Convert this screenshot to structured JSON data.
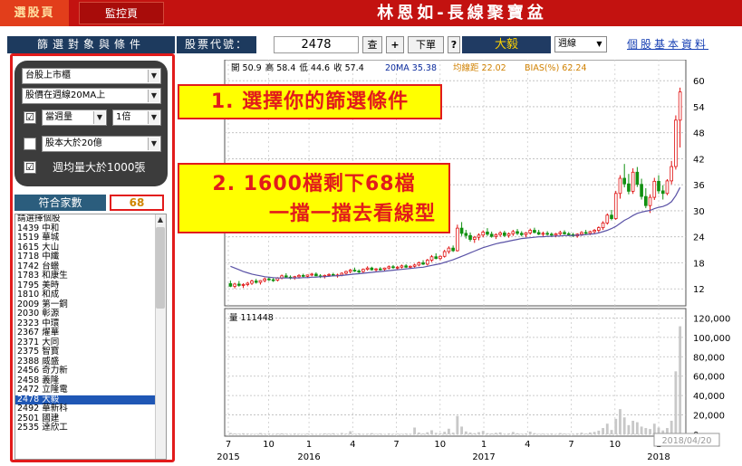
{
  "topbar": {
    "tab_active": "選股頁",
    "tab_inactive": "監控頁",
    "title": "林恩如-長線聚寶盆"
  },
  "filter": {
    "header": "篩選對象與條件",
    "market_select": "台股上市櫃",
    "price_condition": "股價在週線20MA上",
    "volume_checked": true,
    "volume_select": "當週量",
    "volume_multiple": "1倍",
    "capital_checked": false,
    "capital_select": "股本大於20億",
    "avg_volume_checked": true,
    "avg_volume_label": "週均量大於1000張",
    "match_label": "符合家數",
    "match_count": "68",
    "list_header": "請選擇個股",
    "stocks": [
      "1439 中和",
      "1519 華城",
      "1615 大山",
      "1718 中纖",
      "1742 台蠟",
      "1783 和康生",
      "1795 美時",
      "1810 和成",
      "2009 第一銅",
      "2030 彰源",
      "2323 中環",
      "2367 燿華",
      "2371 大同",
      "2375 智寶",
      "2388 威盛",
      "2456 奇力新",
      "2458 義隆",
      "2472 立隆電",
      "2478 大毅",
      "2492 華新科",
      "2501 國建",
      "2535 達欣工"
    ],
    "selected_stock": "2478 大毅"
  },
  "toolbar": {
    "code_label": "股票代號：",
    "code_value": "2478",
    "query_button": "查",
    "add_button": "+",
    "order_button": "下單",
    "help_button": "?",
    "stock_name": "大毅",
    "period": "週線",
    "info_link": "個股基本資料"
  },
  "callouts": {
    "step1": "1. 選擇你的篩選條件",
    "step2_line1": "2. 1600檔剩下68檔",
    "step2_line2": "一擋一擋去看線型"
  },
  "chart_data": {
    "type": "candlestick",
    "header": {
      "open": "開 50.9",
      "high": "高 58.4",
      "low": "低 44.6",
      "close": "收 57.4",
      "ma": "20MA 35.38",
      "ma_dist": "均線距 22.02",
      "bias": "BIAS(%) 62.24"
    },
    "volume_label": "量 111448",
    "price_axis": [
      60,
      54,
      48,
      42,
      36,
      30,
      24,
      18,
      12
    ],
    "volume_axis": [
      "120,000",
      "100,000",
      "80,000",
      "60,000",
      "40,000",
      "20,000",
      "0"
    ],
    "x_month_labels": [
      "7",
      "10",
      "1",
      "4",
      "7",
      "10",
      "1",
      "4",
      "7",
      "10",
      "1"
    ],
    "x_year_labels": [
      "2015",
      "2016",
      "2017",
      "2018"
    ],
    "last_date": "2018/04/20",
    "price_range": [
      8.5,
      64
    ],
    "volume_range": [
      0,
      126000
    ],
    "colors": {
      "up": "#e01010",
      "down": "#109010",
      "ma": "#5a52a6",
      "volume": "#c8c8c8"
    },
    "ohlc": [
      [
        13.2,
        13.9,
        12.4,
        12.6
      ],
      [
        12.6,
        13.4,
        12.1,
        13.1
      ],
      [
        13.1,
        13.8,
        12.5,
        12.8
      ],
      [
        12.8,
        13.3,
        12.2,
        13.0
      ],
      [
        13.0,
        13.6,
        12.6,
        13.3
      ],
      [
        13.3,
        14.1,
        12.9,
        13.8
      ],
      [
        13.8,
        14.3,
        13.2,
        13.5
      ],
      [
        13.5,
        14.0,
        13.0,
        13.9
      ],
      [
        13.9,
        14.6,
        13.5,
        14.3
      ],
      [
        14.3,
        14.8,
        13.8,
        14.1
      ],
      [
        14.1,
        14.5,
        13.6,
        14.0
      ],
      [
        14.0,
        14.7,
        13.7,
        14.5
      ],
      [
        14.5,
        15.3,
        14.2,
        15.0
      ],
      [
        15.0,
        15.6,
        14.6,
        14.7
      ],
      [
        14.7,
        15.1,
        14.2,
        14.6
      ],
      [
        14.6,
        15.0,
        14.1,
        14.8
      ],
      [
        14.8,
        15.4,
        14.4,
        15.1
      ],
      [
        15.1,
        15.5,
        14.6,
        14.9
      ],
      [
        14.9,
        15.3,
        14.5,
        15.2
      ],
      [
        15.2,
        15.7,
        14.9,
        15.4
      ],
      [
        15.4,
        15.8,
        14.9,
        15.0
      ],
      [
        15.0,
        15.4,
        14.5,
        14.9
      ],
      [
        14.9,
        15.3,
        14.4,
        15.1
      ],
      [
        15.1,
        15.6,
        14.8,
        15.3
      ],
      [
        15.3,
        15.7,
        14.9,
        15.0
      ],
      [
        15.0,
        15.5,
        14.6,
        15.2
      ],
      [
        15.2,
        15.8,
        14.9,
        15.6
      ],
      [
        15.6,
        16.2,
        15.3,
        16.0
      ],
      [
        16.0,
        16.6,
        15.6,
        16.3
      ],
      [
        16.3,
        16.9,
        15.9,
        16.1
      ],
      [
        16.1,
        16.5,
        15.6,
        16.0
      ],
      [
        16.0,
        16.7,
        15.7,
        16.5
      ],
      [
        16.5,
        17.2,
        16.2,
        16.8
      ],
      [
        16.8,
        17.1,
        16.2,
        16.4
      ],
      [
        16.4,
        16.8,
        15.9,
        16.6
      ],
      [
        16.6,
        17.0,
        16.2,
        16.5
      ],
      [
        16.5,
        16.9,
        16.0,
        16.8
      ],
      [
        16.8,
        17.4,
        16.5,
        17.1
      ],
      [
        17.1,
        17.5,
        16.6,
        16.9
      ],
      [
        16.9,
        17.3,
        16.4,
        17.0
      ],
      [
        17.0,
        17.6,
        16.7,
        17.3
      ],
      [
        17.3,
        17.7,
        16.8,
        17.0
      ],
      [
        17.0,
        17.4,
        16.6,
        17.2
      ],
      [
        17.2,
        17.8,
        16.9,
        17.5
      ],
      [
        17.5,
        18.3,
        17.2,
        18.0
      ],
      [
        18.0,
        18.6,
        17.5,
        17.7
      ],
      [
        17.7,
        18.9,
        17.4,
        18.6
      ],
      [
        18.6,
        19.8,
        18.2,
        19.4
      ],
      [
        19.4,
        20.2,
        18.8,
        19.0
      ],
      [
        19.0,
        19.7,
        18.6,
        19.5
      ],
      [
        19.5,
        21.0,
        19.2,
        20.6
      ],
      [
        20.6,
        21.8,
        20.1,
        21.4
      ],
      [
        21.4,
        22.0,
        20.5,
        20.8
      ],
      [
        20.8,
        26.8,
        20.6,
        26.0
      ],
      [
        26.0,
        27.4,
        24.2,
        24.8
      ],
      [
        24.8,
        25.6,
        23.6,
        24.3
      ],
      [
        24.3,
        25.0,
        22.9,
        23.4
      ],
      [
        23.4,
        24.2,
        22.6,
        23.9
      ],
      [
        23.9,
        24.8,
        23.2,
        24.4
      ],
      [
        24.4,
        25.5,
        23.9,
        25.1
      ],
      [
        25.1,
        26.0,
        24.2,
        24.6
      ],
      [
        24.6,
        25.2,
        23.8,
        24.1
      ],
      [
        24.1,
        24.8,
        23.5,
        24.5
      ],
      [
        24.5,
        25.3,
        24.0,
        24.9
      ],
      [
        24.9,
        25.4,
        24.0,
        24.3
      ],
      [
        24.3,
        25.0,
        23.8,
        24.7
      ],
      [
        24.7,
        25.6,
        24.2,
        25.2
      ],
      [
        25.2,
        25.8,
        24.4,
        24.8
      ],
      [
        24.8,
        25.3,
        24.1,
        24.5
      ],
      [
        24.5,
        25.1,
        23.9,
        24.9
      ],
      [
        24.9,
        25.9,
        24.5,
        25.5
      ],
      [
        25.5,
        26.1,
        24.8,
        25.0
      ],
      [
        25.0,
        25.6,
        24.4,
        24.6
      ],
      [
        24.6,
        25.2,
        24.0,
        24.8
      ],
      [
        24.8,
        25.3,
        24.3,
        24.6
      ],
      [
        24.6,
        25.0,
        24.0,
        24.4
      ],
      [
        24.4,
        24.9,
        23.9,
        24.7
      ],
      [
        24.7,
        25.4,
        24.3,
        25.0
      ],
      [
        25.0,
        25.5,
        24.5,
        24.7
      ],
      [
        24.7,
        25.1,
        24.2,
        24.5
      ],
      [
        24.5,
        24.9,
        24.0,
        24.2
      ],
      [
        24.2,
        24.8,
        23.8,
        24.6
      ],
      [
        24.6,
        25.3,
        24.2,
        25.0
      ],
      [
        25.0,
        25.6,
        24.6,
        24.8
      ],
      [
        24.8,
        25.4,
        24.4,
        25.2
      ],
      [
        25.2,
        25.8,
        24.7,
        25.5
      ],
      [
        25.5,
        26.4,
        25.0,
        26.1
      ],
      [
        26.1,
        27.6,
        25.6,
        27.2
      ],
      [
        27.2,
        29.4,
        26.8,
        29.0
      ],
      [
        29.0,
        30.2,
        27.8,
        28.2
      ],
      [
        28.2,
        34.6,
        27.9,
        34.0
      ],
      [
        34.0,
        38.2,
        32.8,
        37.5
      ],
      [
        37.5,
        40.8,
        35.4,
        36.2
      ],
      [
        36.2,
        38.5,
        33.8,
        34.5
      ],
      [
        34.5,
        39.8,
        33.9,
        38.9
      ],
      [
        38.9,
        40.1,
        35.5,
        36.1
      ],
      [
        36.1,
        37.4,
        32.6,
        33.3
      ],
      [
        33.3,
        35.2,
        30.6,
        31.2
      ],
      [
        31.2,
        33.8,
        29.5,
        33.1
      ],
      [
        33.1,
        37.6,
        32.5,
        36.8
      ],
      [
        36.8,
        38.2,
        33.9,
        34.6
      ],
      [
        34.6,
        35.9,
        32.6,
        34.0
      ],
      [
        34.0,
        37.3,
        33.6,
        36.9
      ],
      [
        36.9,
        41.5,
        36.1,
        40.2
      ],
      [
        40.2,
        52.0,
        39.5,
        50.9
      ],
      [
        50.9,
        58.4,
        44.6,
        57.4
      ]
    ],
    "volumes": [
      1500,
      900,
      700,
      1100,
      800,
      600,
      500,
      1300,
      700,
      900,
      600,
      800,
      1000,
      700,
      500,
      900,
      600,
      400,
      800,
      700,
      500,
      600,
      900,
      700,
      1100,
      500,
      1400,
      800,
      3200,
      600,
      900,
      600,
      700,
      1200,
      500,
      800,
      400,
      900,
      600,
      700,
      500,
      800,
      600,
      7000,
      1800,
      900,
      2100,
      4200,
      1500,
      1200,
      2600,
      5800,
      1700,
      19000,
      8000,
      3000,
      1800,
      1200,
      2200,
      3500,
      1200,
      900,
      1500,
      2000,
      700,
      900,
      2400,
      1100,
      600,
      900,
      2800,
      1200,
      500,
      700,
      600,
      900,
      500,
      1300,
      800,
      600,
      700,
      1100,
      1700,
      800,
      1900,
      2500,
      3800,
      6500,
      11000,
      4500,
      16000,
      26000,
      17500,
      9500,
      14000,
      12500,
      8000,
      6500,
      5500,
      11000,
      7000,
      4000,
      6500,
      14000,
      65000,
      111448
    ],
    "ma20": [
      17.2,
      16.8,
      16.4,
      16.0,
      15.7,
      15.4,
      15.2,
      15.0,
      14.8,
      14.7,
      14.6,
      14.5,
      14.5,
      14.5,
      14.5,
      14.5,
      14.5,
      14.6,
      14.6,
      14.7,
      14.7,
      14.8,
      14.8,
      14.9,
      15.0,
      15.0,
      15.1,
      15.2,
      15.3,
      15.4,
      15.5,
      15.6,
      15.7,
      15.8,
      15.9,
      16.0,
      16.1,
      16.2,
      16.3,
      16.4,
      16.5,
      16.6,
      16.7,
      16.8,
      16.9,
      17.0,
      17.2,
      17.4,
      17.6,
      17.8,
      18.1,
      18.4,
      18.7,
      19.1,
      19.5,
      19.9,
      20.3,
      20.7,
      21.1,
      21.5,
      21.8,
      22.1,
      22.4,
      22.6,
      22.8,
      23.0,
      23.2,
      23.4,
      23.6,
      23.7,
      23.8,
      23.9,
      24.0,
      24.0,
      24.1,
      24.1,
      24.2,
      24.2,
      24.3,
      24.3,
      24.3,
      24.4,
      24.4,
      24.5,
      24.6,
      24.7,
      24.9,
      25.2,
      25.5,
      25.9,
      26.4,
      27.1,
      27.8,
      28.3,
      28.9,
      29.4,
      29.7,
      29.9,
      30.1,
      30.5,
      30.8,
      31.0,
      31.4,
      32.1,
      33.5,
      35.38
    ]
  }
}
